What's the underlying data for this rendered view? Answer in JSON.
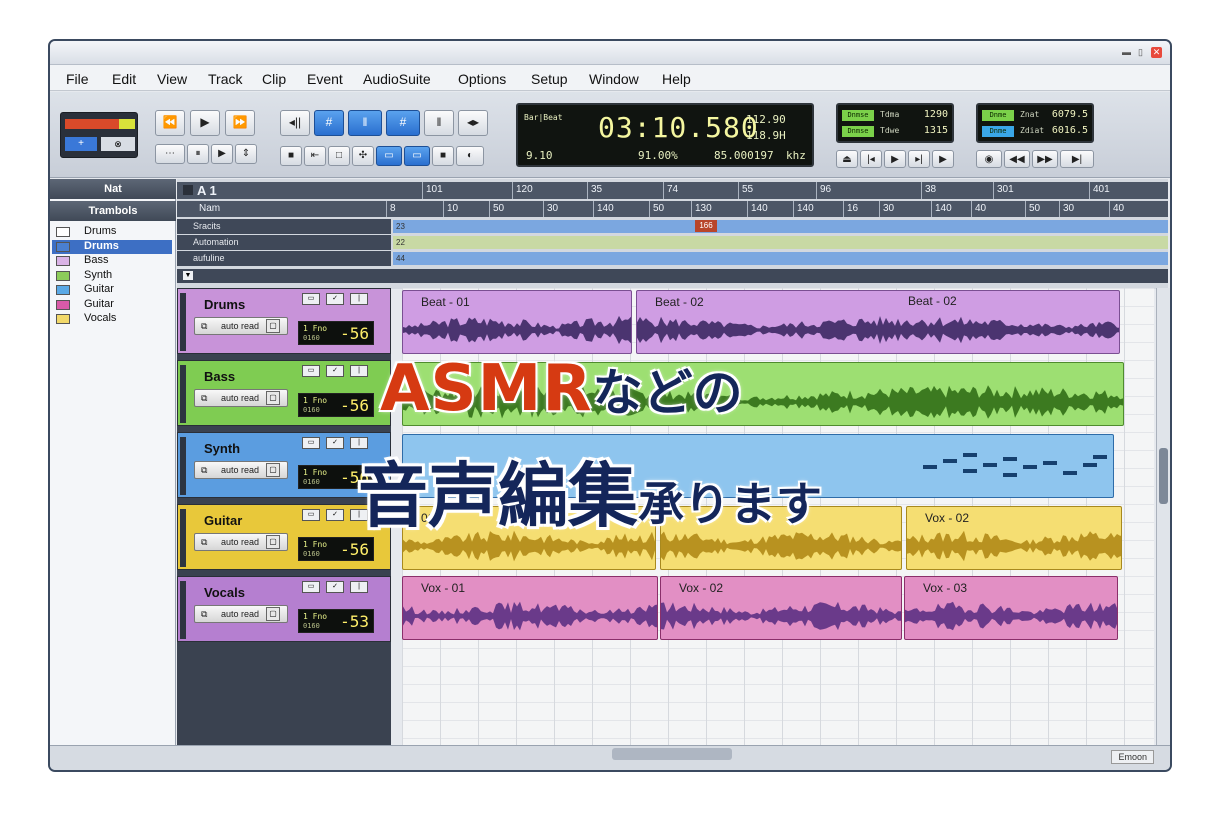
{
  "menu": [
    "File",
    "Edit",
    "View",
    "Track",
    "Clip",
    "Event",
    "AudioSuite",
    "Options",
    "Setup",
    "Window",
    "Help"
  ],
  "transport": {
    "rew": "⏪",
    "play": "▶",
    "ff": "⏩",
    "grid": "#",
    "edit_btns": [
      "◂||",
      "#",
      "‖",
      "◂▸"
    ],
    "row2": [
      "⋯",
      "⏸",
      "▶",
      "⇕"
    ],
    "tools": [
      "■",
      "⇤",
      "□",
      "✣",
      "▭",
      "▭",
      "■",
      "◐"
    ]
  },
  "counter": {
    "main": "03:10.580",
    "bars_label": "Bar|Beat",
    "tempo": "112.90",
    "rate": "118.9H",
    "left_val": "9.10",
    "pct": "91.00%",
    "freq": "85.000197",
    "freq_unit": "khz"
  },
  "meters1": {
    "tag1": "Dnmse",
    "lbl1": "Tdma",
    "val1": "1290",
    "tag2": "Dnmse",
    "lbl2": "Tdwe",
    "val2": "1315"
  },
  "meters2": {
    "tag1": "Dnme",
    "lbl1": "Znat",
    "val1": "6079.5",
    "tag2": "Dnme",
    "lbl2": "Zdiat",
    "val2": "6016.5"
  },
  "meter_btns1": [
    "⏏",
    "|◂",
    "▶",
    "▸|",
    "▶"
  ],
  "meter_btns2": [
    "◉",
    "◀◀",
    "▶▶",
    "▶|"
  ],
  "left_panel": {
    "head1": "Nat",
    "head2": "Trambols",
    "items": [
      {
        "label": "Drums",
        "color": "#ffffff"
      },
      {
        "label": "Drums",
        "color": "#4a7fd0",
        "selected": true
      },
      {
        "label": "Bass",
        "color": "#d9b3e6"
      },
      {
        "label": "Synth",
        "color": "#8ccc5a"
      },
      {
        "label": "Guitar",
        "color": "#5aa9e6"
      },
      {
        "label": "Guitar",
        "color": "#d95aa8"
      },
      {
        "label": "Vocals",
        "color": "#f2d96a"
      }
    ]
  },
  "ruler": {
    "row1_label": "A 1",
    "row1": [
      "101",
      "120",
      "35",
      "74",
      "55",
      "96",
      "38",
      "301",
      "401"
    ],
    "row2_label": "Nam",
    "row2": [
      "8",
      "10",
      "50",
      "30",
      "140",
      "50",
      "130",
      "140",
      "140",
      "16",
      "30",
      "140",
      "40",
      "50",
      "30",
      "40"
    ],
    "marker": "166"
  },
  "automation": [
    {
      "name": "Sracits",
      "val": "23",
      "color": "#7ba7e0"
    },
    {
      "name": "Automation",
      "val": "22",
      "color": "#c8d9a4"
    },
    {
      "name": "aufuline",
      "val": "44",
      "color": "#7ba7e0"
    }
  ],
  "tracks": [
    {
      "name": "Drums",
      "color": "#c893d9",
      "auto": "auto read",
      "fader_a": "1  Fno",
      "fader_b": "0160",
      "vol": "-56"
    },
    {
      "name": "Bass",
      "color": "#7fcc52",
      "auto": "auto read",
      "fader_a": "1  Fno",
      "fader_b": "0160",
      "vol": "-56"
    },
    {
      "name": "Synth",
      "color": "#5b9de0",
      "auto": "auto read",
      "fader_a": "1  Fno",
      "fader_b": "0160",
      "vol": "-56"
    },
    {
      "name": "Guitar",
      "color": "#e8c83a",
      "auto": "auto read",
      "fader_a": "1  Fno",
      "fader_b": "0160",
      "vol": "-56"
    },
    {
      "name": "Vocals",
      "color": "#b57fd0",
      "auto": "auto read",
      "fader_a": "1  Fno",
      "fader_b": "0160",
      "vol": "-53"
    }
  ],
  "clips": {
    "drums": [
      "Beat - 01",
      "Beat - 02",
      "Beat - 02"
    ],
    "guitar": [
      "01",
      "Vox - 02"
    ],
    "vocals": [
      "Vox - 01",
      "Vox - 02",
      "Vox - 03"
    ]
  },
  "status": {
    "right": "Emoon"
  },
  "overlay": {
    "line1_a": "ASMR",
    "line1_b": "などの",
    "line2_a": "音声編集",
    "line2_b": "承ります"
  }
}
